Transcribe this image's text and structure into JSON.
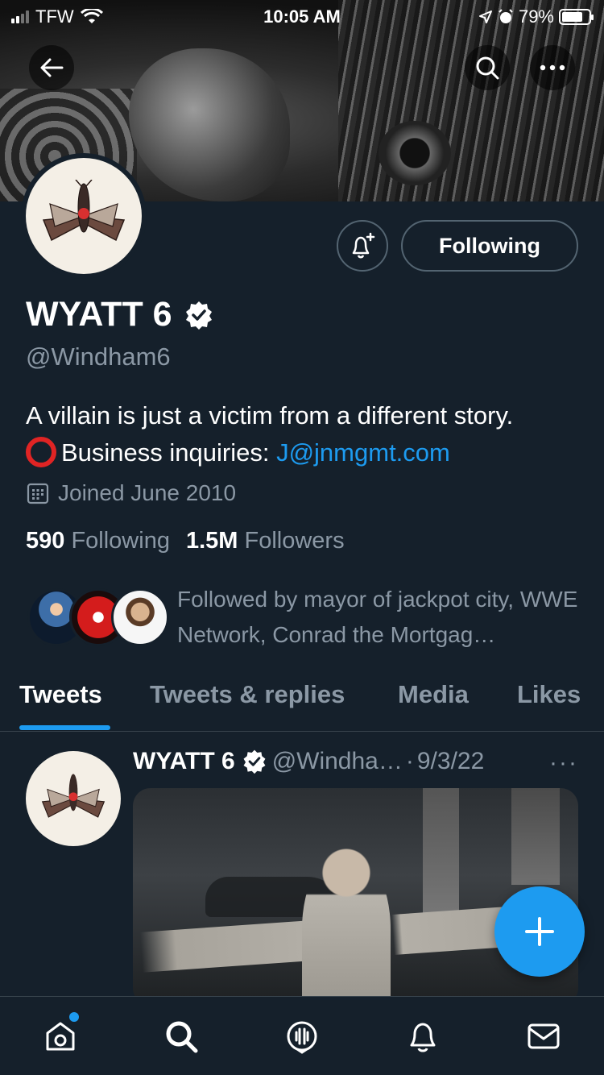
{
  "status_bar": {
    "carrier": "TFW",
    "time": "10:05 AM",
    "battery": "79%",
    "battery_level": 0.79
  },
  "profile": {
    "display_name": "WYATT 6",
    "handle": "@Windham6",
    "bio_line1": "A villain is just a victim from a different story.",
    "bio_line2_prefix": "Business inquiries: ",
    "bio_link": "J@jnmgmt.com",
    "joined": "Joined June 2010",
    "following_count": "590",
    "following_label": "Following",
    "followers_count": "1.5M",
    "followers_label": "Followers",
    "followed_by": "Followed by mayor of jackpot city, WWE Network, Conrad the Mortgag…",
    "following_button": "Following"
  },
  "tabs": [
    {
      "label": "Tweets",
      "active": true
    },
    {
      "label": "Tweets & replies",
      "active": false
    },
    {
      "label": "Media",
      "active": false
    },
    {
      "label": "Likes",
      "active": false
    }
  ],
  "tweet": {
    "name": "WYATT 6",
    "handle": "@Windha…",
    "separator": "·",
    "date": "9/3/22",
    "more": "···"
  },
  "icons": {
    "back": "back-arrow-icon",
    "search": "search-icon",
    "more": "more-icon",
    "bell": "bell-plus-icon",
    "verified": "verified-badge-icon",
    "calendar": "calendar-icon",
    "compose": "plus-icon",
    "nav": [
      "home-icon",
      "search-icon",
      "spaces-icon",
      "notifications-icon",
      "messages-icon"
    ]
  },
  "colors": {
    "background": "#15202b",
    "accent": "#1d9bf0",
    "muted": "#8b98a5"
  }
}
